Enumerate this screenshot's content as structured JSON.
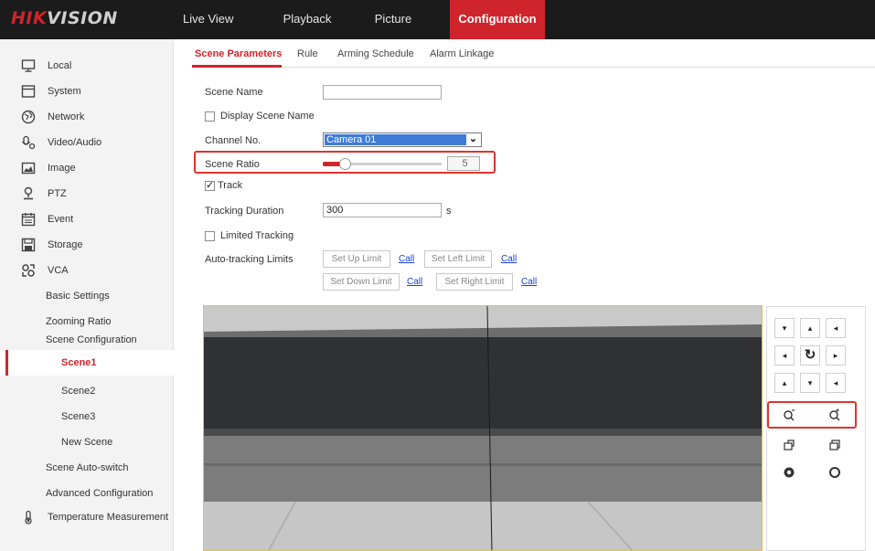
{
  "brand": {
    "hik": "HIK",
    "vision": "VISION"
  },
  "topnav": [
    "Live View",
    "Playback",
    "Picture",
    "Configuration"
  ],
  "sidebar": {
    "items": [
      {
        "label": "Local",
        "icon": "monitor-icon"
      },
      {
        "label": "System",
        "icon": "system-icon"
      },
      {
        "label": "Network",
        "icon": "globe-icon"
      },
      {
        "label": "Video/Audio",
        "icon": "video-audio-icon"
      },
      {
        "label": "Image",
        "icon": "image-icon"
      },
      {
        "label": "PTZ",
        "icon": "ptz-icon"
      },
      {
        "label": "Event",
        "icon": "calendar-icon"
      },
      {
        "label": "Storage",
        "icon": "storage-icon"
      },
      {
        "label": "VCA",
        "icon": "vca-icon"
      }
    ],
    "vca_sub": [
      "Basic Settings",
      "Zooming Ratio",
      "Scene Configuration"
    ],
    "scenes": [
      "Scene1",
      "Scene2",
      "Scene3",
      "New Scene"
    ],
    "after": [
      "Scene Auto-switch",
      "Advanced Configuration"
    ],
    "temperature": "Temperature Measurement"
  },
  "tabs": [
    "Scene Parameters",
    "Rule",
    "Arming Schedule",
    "Alarm Linkage"
  ],
  "form": {
    "scene_name_label": "Scene Name",
    "scene_name_value": "",
    "display_scene_name": "Display Scene Name",
    "channel_label": "Channel No.",
    "channel_value": "Camera 01",
    "scene_ratio_label": "Scene Ratio",
    "scene_ratio_value": "5",
    "scene_ratio_fraction": 0.15,
    "track_label": "Track",
    "tracking_duration_label": "Tracking Duration",
    "tracking_duration_value": "300",
    "tracking_duration_unit": "s",
    "limited_tracking": "Limited Tracking",
    "auto_limits_label": "Auto-tracking Limits",
    "set_up_limit": "Set Up Limit",
    "set_left_limit": "Set Left Limit",
    "set_down_limit": "Set Down Limit",
    "set_right_limit": "Set Right Limit",
    "call": "Call"
  },
  "ptz": {
    "arrows": [
      "▾",
      "▴",
      "◂",
      "◂",
      "↻",
      "▸",
      "▴",
      "▾",
      "◂"
    ],
    "zoom_out": "⌕⁻",
    "zoom_in": "⌕⁺"
  },
  "colors": {
    "accent": "#d0242c",
    "highlight": "#e0322e",
    "link": "#1a3fd6"
  }
}
